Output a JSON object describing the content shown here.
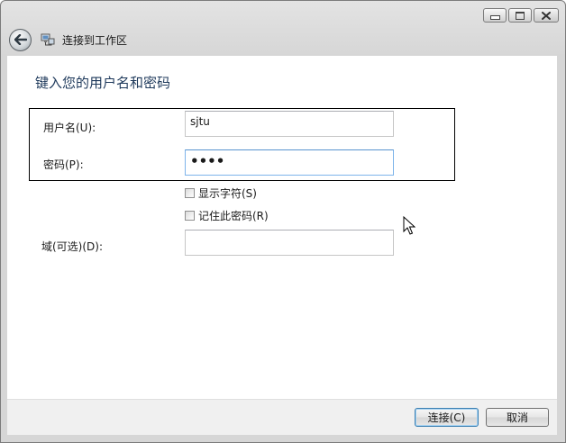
{
  "window": {
    "nav_title": "连接到工作区"
  },
  "form": {
    "heading": "键入您的用户名和密码",
    "username_label": "用户名(U):",
    "username_value": "sjtu",
    "password_label": "密码(P):",
    "password_value": "••••",
    "show_chars_label": "显示字符(S)",
    "remember_label": "记住此密码(R)",
    "domain_label": "域(可选)(D):",
    "domain_value": ""
  },
  "footer": {
    "connect_label": "连接(C)",
    "cancel_label": "取消"
  }
}
